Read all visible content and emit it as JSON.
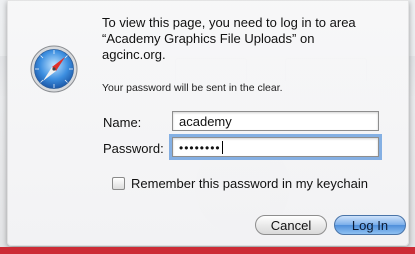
{
  "dialog": {
    "message_lines": [
      "To view this page, you need to log in to area",
      "“Academy Graphics File Uploads” on",
      "agcinc.org."
    ],
    "note": "Your password will be sent in the clear.",
    "name_label": "Name:",
    "name_value": "academy",
    "password_label": "Password:",
    "password_value": "••••••••",
    "remember_label": "Remember this password in my keychain",
    "cancel_label": "Cancel",
    "login_label": "Log In"
  },
  "colors": {
    "accent_bar": "#cc2b35",
    "default_button": "#4f8fdb",
    "focus_ring": "#5f98dc"
  },
  "icons": {
    "app": "safari-compass-icon"
  }
}
